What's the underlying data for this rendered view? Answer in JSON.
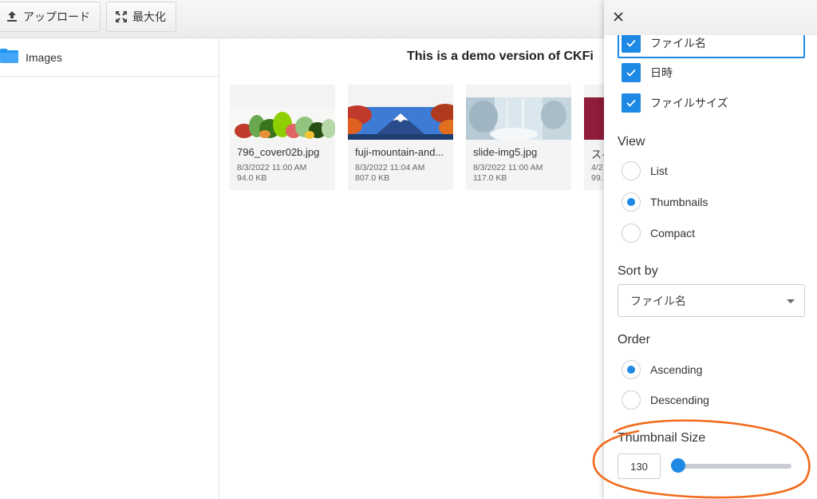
{
  "toolbar": {
    "upload_label": "アップロード",
    "maximize_label": "最大化"
  },
  "folders": {
    "items": [
      {
        "label": "Images",
        "icon": "folder-icon"
      }
    ]
  },
  "main": {
    "demo_banner": "This is a demo version of CKFi",
    "files": [
      {
        "name": "796_cover02b.jpg",
        "date": "8/3/2022 11:00 AM",
        "size": "94.0 KB"
      },
      {
        "name": "fuji-mountain-and...",
        "date": "8/3/2022 11:04 AM",
        "size": "807.0 KB"
      },
      {
        "name": "slide-img5.jpg",
        "date": "8/3/2022 11:00 AM",
        "size": "117.0 KB"
      },
      {
        "name": "ス·",
        "date": "4/2",
        "size": "99."
      }
    ]
  },
  "settings": {
    "close_icon": "close-icon",
    "display_options": [
      {
        "label": "ファイル名",
        "checked": true
      },
      {
        "label": "日時",
        "checked": true
      },
      {
        "label": "ファイルサイズ",
        "checked": true
      }
    ],
    "view": {
      "label": "View",
      "options": [
        {
          "label": "List",
          "selected": false
        },
        {
          "label": "Thumbnails",
          "selected": true
        },
        {
          "label": "Compact",
          "selected": false
        }
      ]
    },
    "sort_by": {
      "label": "Sort by",
      "value": "ファイル名"
    },
    "order": {
      "label": "Order",
      "options": [
        {
          "label": "Ascending",
          "selected": true
        },
        {
          "label": "Descending",
          "selected": false
        }
      ]
    },
    "thumbnail_size": {
      "label": "Thumbnail Size",
      "value": "130",
      "slider_fraction": 0.05
    }
  },
  "colors": {
    "accent": "#1e88e5",
    "annotation": "#f26a1b"
  }
}
